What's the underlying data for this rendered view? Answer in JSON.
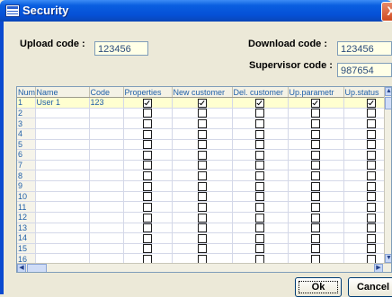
{
  "window": {
    "title": "Security",
    "close_glyph": "X"
  },
  "codes": {
    "upload_label": "Upload code :",
    "upload_value": "123456",
    "download_label": "Download code :",
    "download_value": "123456",
    "supervisor_label": "Supervisor code :",
    "supervisor_value": "987654"
  },
  "grid": {
    "columns": [
      "Num.",
      "Name",
      "Code",
      "Properties",
      "New customer",
      "Del. customer",
      "Up.parametr",
      "Up.status"
    ],
    "rows": [
      {
        "num": "1",
        "name": "User 1",
        "code": "123",
        "checks": [
          true,
          true,
          true,
          true,
          true
        ]
      },
      {
        "num": "2",
        "name": "",
        "code": "",
        "checks": [
          false,
          false,
          false,
          false,
          false
        ]
      },
      {
        "num": "3",
        "name": "",
        "code": "",
        "checks": [
          false,
          false,
          false,
          false,
          false
        ]
      },
      {
        "num": "4",
        "name": "",
        "code": "",
        "checks": [
          false,
          false,
          false,
          false,
          false
        ]
      },
      {
        "num": "5",
        "name": "",
        "code": "",
        "checks": [
          false,
          false,
          false,
          false,
          false
        ]
      },
      {
        "num": "6",
        "name": "",
        "code": "",
        "checks": [
          false,
          false,
          false,
          false,
          false
        ]
      },
      {
        "num": "7",
        "name": "",
        "code": "",
        "checks": [
          false,
          false,
          false,
          false,
          false
        ]
      },
      {
        "num": "8",
        "name": "",
        "code": "",
        "checks": [
          false,
          false,
          false,
          false,
          false
        ]
      },
      {
        "num": "9",
        "name": "",
        "code": "",
        "checks": [
          false,
          false,
          false,
          false,
          false
        ]
      },
      {
        "num": "10",
        "name": "",
        "code": "",
        "checks": [
          false,
          false,
          false,
          false,
          false
        ]
      },
      {
        "num": "11",
        "name": "",
        "code": "",
        "checks": [
          false,
          false,
          false,
          false,
          false
        ]
      },
      {
        "num": "12",
        "name": "",
        "code": "",
        "checks": [
          false,
          false,
          false,
          false,
          false
        ]
      },
      {
        "num": "13",
        "name": "",
        "code": "",
        "checks": [
          false,
          false,
          false,
          false,
          false
        ]
      },
      {
        "num": "14",
        "name": "",
        "code": "",
        "checks": [
          false,
          false,
          false,
          false,
          false
        ]
      },
      {
        "num": "15",
        "name": "",
        "code": "",
        "checks": [
          false,
          false,
          false,
          false,
          false
        ]
      },
      {
        "num": "16",
        "name": "",
        "code": "",
        "checks": [
          false,
          false,
          false,
          false,
          false
        ]
      }
    ]
  },
  "buttons": {
    "ok": "Ok",
    "cancel": "Cancel"
  },
  "icons": {
    "app": "security-window-icon",
    "close": "close-icon",
    "scroll_up": "arrow-up-icon",
    "scroll_down": "arrow-down-icon",
    "scroll_left": "arrow-left-icon",
    "scroll_right": "arrow-right-icon"
  },
  "colors": {
    "titlebar": "#0a5fe0",
    "dialog_bg": "#ece9d8",
    "field_bg": "#ffffe7",
    "grid_text": "#1f5fa8",
    "close": "#d04a20"
  }
}
